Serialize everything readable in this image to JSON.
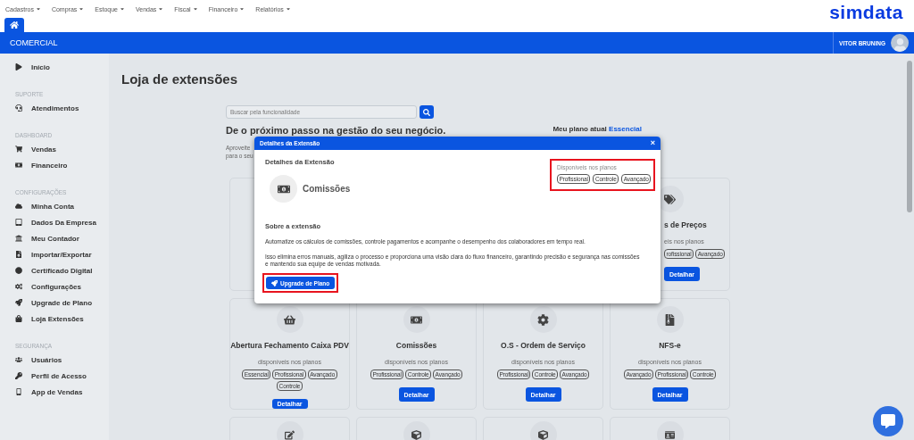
{
  "menu": [
    {
      "label": "Cadastros"
    },
    {
      "label": "Compras"
    },
    {
      "label": "Estoque"
    },
    {
      "label": "Vendas"
    },
    {
      "label": "Fiscal"
    },
    {
      "label": "Financeiro"
    },
    {
      "label": "Relatórios"
    }
  ],
  "logo": "simdata",
  "tabs": [
    {
      "selected": true
    }
  ],
  "header": {
    "section": "COMERCIAL",
    "user": "VITOR BRUNING"
  },
  "sidebar": [
    {
      "items": [
        {
          "label": "Início"
        }
      ]
    },
    {
      "title": "SUPORTE",
      "items": [
        {
          "label": "Atendimentos"
        }
      ]
    },
    {
      "title": "DASHBOARD",
      "items": [
        {
          "label": "Vendas"
        },
        {
          "label": "Financeiro"
        }
      ]
    },
    {
      "title": "CONFIGURAÇÕES",
      "items": [
        {
          "label": "Minha Conta"
        },
        {
          "label": "Dados Da Empresa"
        },
        {
          "label": "Meu Contador"
        },
        {
          "label": "Importar/Exportar"
        },
        {
          "label": "Certificado Digital"
        },
        {
          "label": "Configurações"
        },
        {
          "label": "Upgrade de Plano"
        },
        {
          "label": "Loja Extensões"
        }
      ]
    },
    {
      "title": "SEGURANÇA",
      "items": [
        {
          "label": "Usuários"
        },
        {
          "label": "Perfil de Acesso"
        },
        {
          "label": "App de Vendas"
        }
      ]
    }
  ],
  "page": {
    "title": "Loja de extensões",
    "search": {
      "placeholder": "Buscar pela funcionalidade"
    },
    "heading": "De o próximo passo na gestão do seu negócio.",
    "plan_label": "Meu plano atual",
    "plan_name": "Essencial",
    "intro_lines": [
      "Aproveite",
      "para o seu"
    ]
  },
  "cards": [
    {
      "kind": "covered"
    },
    {
      "kind": "partial",
      "title": "s de Preços",
      "caption": "eis nos planos",
      "tags": [
        "rofissional",
        "Avançado"
      ],
      "button": "Detalhar"
    },
    {
      "kind": "full",
      "title": "Abertura Fechamento Caixa PDV",
      "caption": "disponíveis nos planos",
      "tags": [
        "Essencial",
        "Profissional",
        "Avançado",
        "Controle"
      ],
      "button": "Detalhar"
    },
    {
      "kind": "full",
      "title": "Comissões",
      "caption": "disponíveis nos planos",
      "tags": [
        "Profissional",
        "Controle",
        "Avançado"
      ],
      "button": "Detalhar"
    },
    {
      "kind": "full",
      "title": "O.S - Ordem de Serviço",
      "caption": "disponíveis nos planos",
      "tags": [
        "Profissional",
        "Controle",
        "Avançado"
      ],
      "button": "Detalhar"
    },
    {
      "kind": "full",
      "title": "NFS-e",
      "caption": "disponíveis nos planos",
      "tags": [
        "Avançado",
        "Profissional",
        "Controle"
      ],
      "button": "Detalhar"
    },
    {
      "kind": "cut"
    },
    {
      "kind": "cut"
    },
    {
      "kind": "cut"
    },
    {
      "kind": "cut"
    }
  ],
  "modal": {
    "title": "Detalhes da Extensão",
    "close": "×",
    "section_title": "Detalhes da Extensão",
    "extension_name": "Comissões",
    "plans": {
      "title": "Disponíveis nos planos",
      "tags": [
        "Profissional",
        "Controle",
        "Avançado"
      ],
      "highlighted": true
    },
    "about_title": "Sobre a extensão",
    "paragraphs": [
      "Automatize os cálculos de comissões, controle pagamentos e acompanhe o desempenho dos colaboradores em tempo real.",
      "Isso elimina erros manuais, agiliza o processo e proporciona uma visão clara do fluxo financeiro, garantindo precisão e segurança nas comissões e mantendo sua equipe de vendas motivada."
    ],
    "upgrade_button": {
      "label": "Upgrade de Plano",
      "highlighted": true
    }
  }
}
